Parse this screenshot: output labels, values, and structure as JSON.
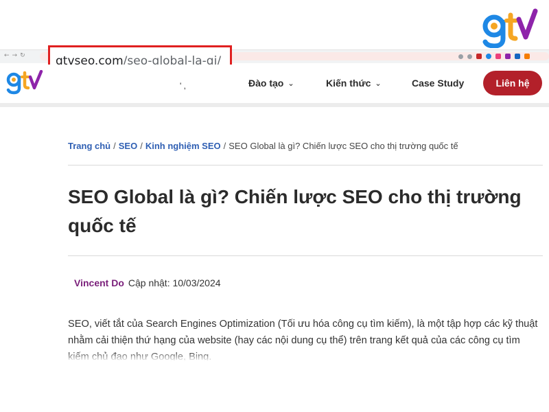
{
  "browser": {
    "url_host": "gtvseo.com",
    "url_path": "/seo-global-la-gi/"
  },
  "brand": {
    "logo_text": "gtv",
    "colors": {
      "g": "#1e88e5",
      "t": "#f5a623",
      "v": "#8e24aa",
      "accent_red": "#b3202a"
    }
  },
  "header": {
    "nav": [
      {
        "label": "Đào tạo"
      },
      {
        "label": "Kiến thức"
      },
      {
        "label": "Case Study"
      }
    ],
    "contact_label": "Liên hệ"
  },
  "breadcrumb": {
    "items": [
      "Trang chủ",
      "SEO",
      "Kinh nghiệm SEO"
    ],
    "current": "SEO Global là gì? Chiến lược SEO cho thị trường quốc tế"
  },
  "article": {
    "title": "SEO Global là gì? Chiến lược SEO cho thị trường quốc tế",
    "author": "Vincent Do",
    "updated": "Cập nhật: 10/03/2024",
    "intro": "SEO, viết tắt của Search Engines Optimization (Tối ưu hóa công cụ tìm kiếm), là một tập hợp các kỹ thuật nhằm cải thiện thứ hạng của website (hay các nội dung cụ thể) trên trang kết quả của các công cụ tìm kiếm chủ đạo như Google, Bing."
  }
}
